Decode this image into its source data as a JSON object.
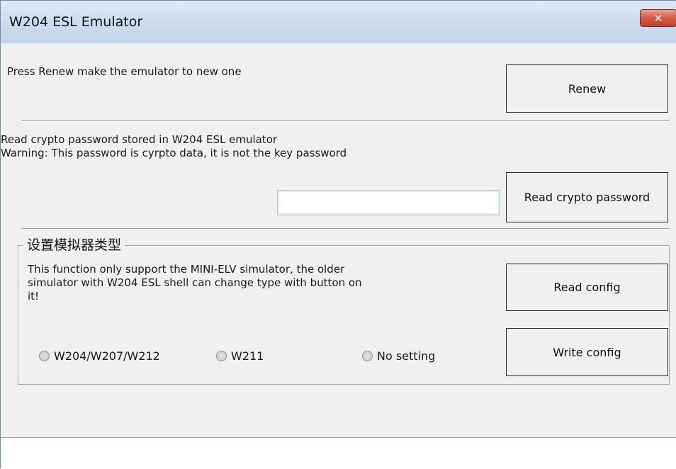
{
  "window": {
    "title": "W204 ESL Emulator",
    "close_label": "✕"
  },
  "renew": {
    "description": "Press Renew make the emulator to new one",
    "button_label": "Renew"
  },
  "crypto": {
    "line1": "Read crypto password stored in W204 ESL emulator",
    "line2": "Warning: This password is cyrpto data, it is not the key password",
    "password_value": "",
    "button_label": "Read crypto password"
  },
  "config": {
    "group_title": "设置模拟器类型",
    "desc_line1": "This function only support the MINI-ELV simulator, the older",
    "desc_line2": "simulator with W204 ESL shell can change type with button on",
    "desc_line3": "it!",
    "read_button": "Read config",
    "write_button": "Write config",
    "options": [
      {
        "label": "W204/W207/W212",
        "selected": false
      },
      {
        "label": "W211",
        "selected": false
      },
      {
        "label": "No setting",
        "selected": false
      }
    ]
  }
}
